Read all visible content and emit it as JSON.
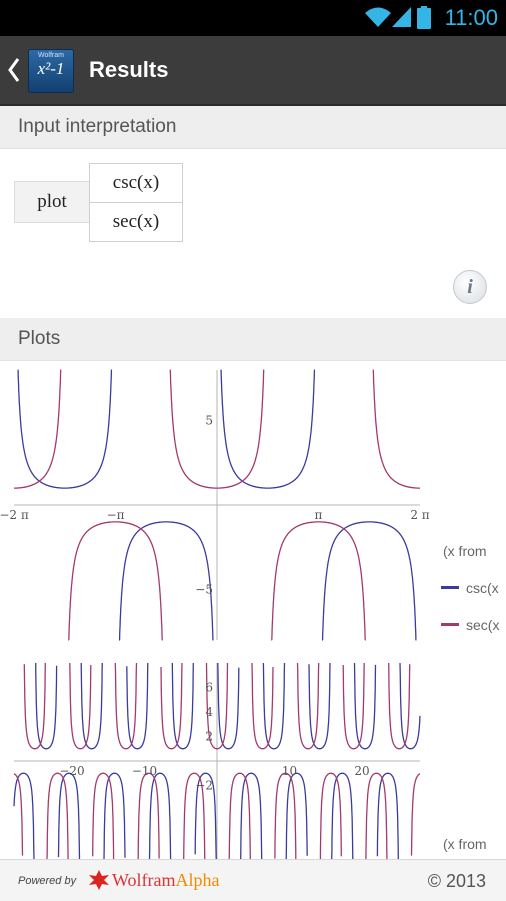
{
  "status_bar": {
    "time": "11:00"
  },
  "action_bar": {
    "title": "Results",
    "app_icon_small": "Wolfram",
    "app_icon_big": "x²-1"
  },
  "input_interpretation": {
    "header": "Input interpretation",
    "command": "plot",
    "functions": [
      "csc(x)",
      "sec(x)"
    ]
  },
  "plots": {
    "header": "Plots",
    "legend_range_text": "(x from",
    "legend": [
      "csc(x",
      "sec(x"
    ]
  },
  "chart_data": [
    {
      "type": "line",
      "x_ticks": [
        "−2 π",
        "−π",
        "π",
        "2 π"
      ],
      "y_ticks": [
        "5",
        "−5"
      ],
      "xlim": [
        -6.2832,
        6.2832
      ],
      "ylim": [
        -8,
        8
      ],
      "series": [
        {
          "name": "csc(x",
          "function": "csc(x)",
          "color": "#3b3b9e"
        },
        {
          "name": "sec(x",
          "function": "sec(x)",
          "color": "#a33a6c"
        }
      ]
    },
    {
      "type": "line",
      "x_ticks": [
        "−20",
        "−10",
        "10",
        "20"
      ],
      "y_ticks": [
        "6",
        "4",
        "2",
        "−2"
      ],
      "xlim": [
        -28,
        28
      ],
      "ylim": [
        -8,
        8
      ],
      "series": [
        {
          "name": "csc(x",
          "function": "csc(x)",
          "color": "#3b3b9e"
        },
        {
          "name": "sec(x",
          "function": "sec(x)",
          "color": "#a33a6c"
        }
      ]
    }
  ],
  "footer": {
    "powered_by": "Powered by",
    "brand_part1": "Wolfram",
    "brand_part2": "Alpha",
    "copyright": "© 2013"
  },
  "colors": {
    "csc": "#3b3b9e",
    "sec": "#a33a6c",
    "status_accent": "#35b5e5",
    "action_bar": "#3c3c3c"
  }
}
